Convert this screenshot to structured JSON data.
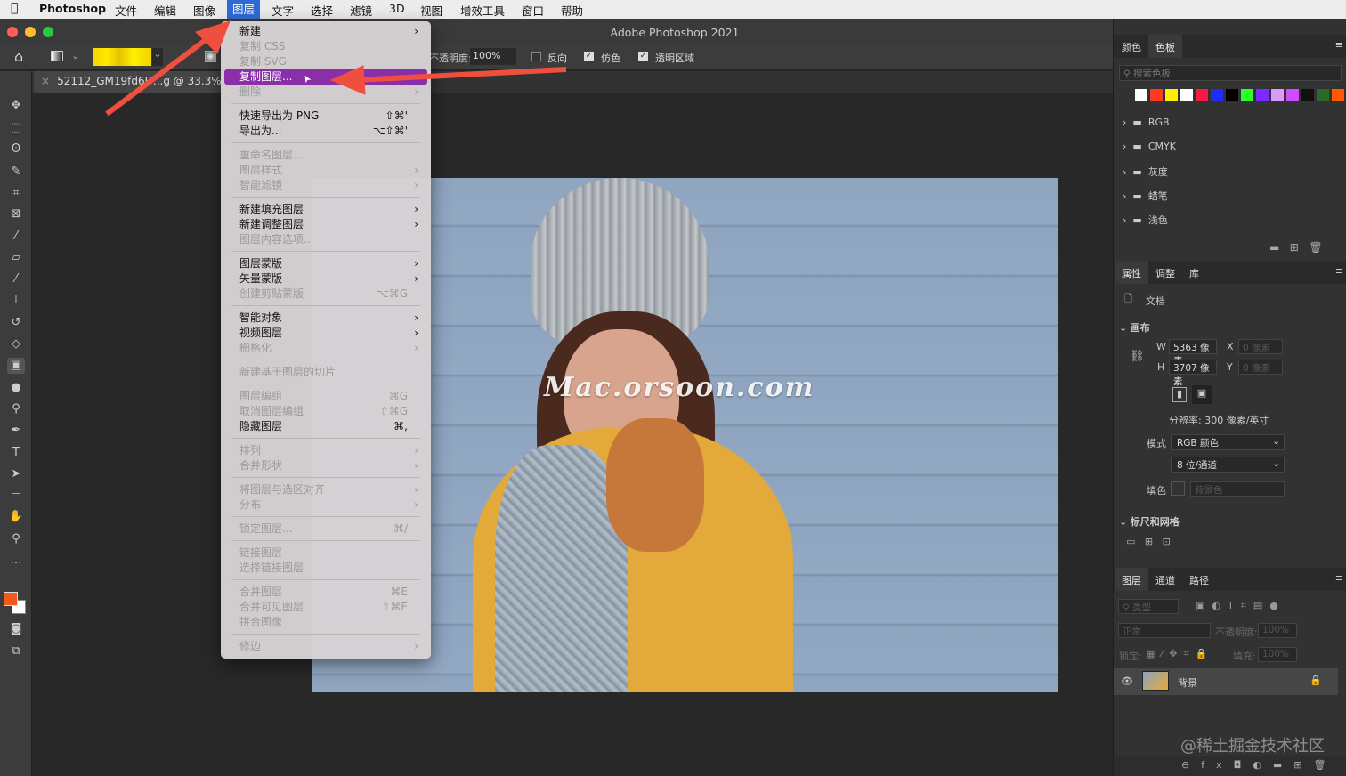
{
  "menubar": {
    "apple": "",
    "items": [
      "Photoshop",
      "文件",
      "编辑",
      "图像",
      "图层",
      "文字",
      "选择",
      "滤镜",
      "3D",
      "视图",
      "增效工具",
      "窗口",
      "帮助"
    ],
    "active": "图层"
  },
  "window": {
    "title": "Adobe Photoshop 2021"
  },
  "options": {
    "opacity_label": "不透明度:",
    "opacity_value": "100%",
    "reverse": "反向",
    "dither": "仿色",
    "transparency": "透明区域",
    "reverse_checked": false,
    "dither_checked": true,
    "transparency_checked": true,
    "gradient_colors": [
      "#f7d800",
      "#ffef00"
    ]
  },
  "document": {
    "tab": "52112_GM19fd6D...g @ 33.3%(RGB"
  },
  "watermark": "Mac.orsoon.com",
  "layer_menu": [
    {
      "label": "新建",
      "sub": true
    },
    {
      "label": "复制 CSS",
      "disabled": true
    },
    {
      "label": "复制 SVG",
      "disabled": true
    },
    {
      "label": "复制图层...",
      "highlight": true
    },
    {
      "label": "删除",
      "disabled": true,
      "sub": true
    },
    {
      "sep": true
    },
    {
      "label": "快速导出为 PNG",
      "shortcut": "⇧⌘'"
    },
    {
      "label": "导出为...",
      "shortcut": "⌥⇧⌘'"
    },
    {
      "sep": true
    },
    {
      "label": "重命名图层...",
      "disabled": true
    },
    {
      "label": "图层样式",
      "disabled": true,
      "sub": true
    },
    {
      "label": "智能滤镜",
      "disabled": true,
      "sub": true
    },
    {
      "sep": true
    },
    {
      "label": "新建填充图层",
      "sub": true
    },
    {
      "label": "新建调整图层",
      "sub": true
    },
    {
      "label": "图层内容选项...",
      "disabled": true
    },
    {
      "sep": true
    },
    {
      "label": "图层蒙版",
      "sub": true
    },
    {
      "label": "矢量蒙版",
      "sub": true
    },
    {
      "label": "创建剪贴蒙版",
      "disabled": true,
      "shortcut": "⌥⌘G"
    },
    {
      "sep": true
    },
    {
      "label": "智能对象",
      "sub": true
    },
    {
      "label": "视频图层",
      "sub": true
    },
    {
      "label": "栅格化",
      "disabled": true,
      "sub": true
    },
    {
      "sep": true
    },
    {
      "label": "新建基于图层的切片",
      "disabled": true
    },
    {
      "sep": true
    },
    {
      "label": "图层编组",
      "disabled": true,
      "shortcut": "⌘G"
    },
    {
      "label": "取消图层编组",
      "disabled": true,
      "shortcut": "⇧⌘G"
    },
    {
      "label": "隐藏图层",
      "shortcut": "⌘,"
    },
    {
      "sep": true
    },
    {
      "label": "排列",
      "disabled": true,
      "sub": true
    },
    {
      "label": "合并形状",
      "disabled": true,
      "sub": true
    },
    {
      "sep": true
    },
    {
      "label": "将图层与选区对齐",
      "disabled": true,
      "sub": true
    },
    {
      "label": "分布",
      "disabled": true,
      "sub": true
    },
    {
      "sep": true
    },
    {
      "label": "锁定图层...",
      "disabled": true,
      "shortcut": "⌘/"
    },
    {
      "sep": true
    },
    {
      "label": "链接图层",
      "disabled": true
    },
    {
      "label": "选择链接图层",
      "disabled": true
    },
    {
      "sep": true
    },
    {
      "label": "合并图层",
      "disabled": true,
      "shortcut": "⌘E"
    },
    {
      "label": "合并可见图层",
      "disabled": true,
      "shortcut": "⇧⌘E"
    },
    {
      "label": "拼合图像",
      "disabled": true
    },
    {
      "sep": true
    },
    {
      "label": "修边",
      "disabled": true,
      "sub": true
    }
  ],
  "swatches_panel": {
    "tabs": [
      "颜色",
      "色板"
    ],
    "search_placeholder": "搜索色板",
    "colors": [
      "#ffffff",
      "#ff3b1f",
      "#ffee00",
      "#ffffff",
      "#ff1744",
      "#1d2dff",
      "#000000",
      "#2cff2c",
      "#7a2cff",
      "#dd99ff",
      "#d24cff",
      "#101010",
      "#2a6a2a",
      "#ff5a00"
    ],
    "folders": [
      "RGB",
      "CMYK",
      "灰度",
      "蜡笔",
      "浅色"
    ]
  },
  "properties_panel": {
    "tabs": [
      "属性",
      "调整",
      "库"
    ],
    "doc_label": "文档",
    "canvas_section": "画布",
    "w_label": "W",
    "w_value": "5363 像素",
    "h_label": "H",
    "h_value": "3707 像素",
    "x_label": "X",
    "x_value": "0 像素",
    "y_label": "Y",
    "y_value": "0 像素",
    "resolution": "分辨率: 300 像素/英寸",
    "mode_label": "模式",
    "mode_value": "RGB 颜色",
    "depth_value": "8 位/通道",
    "fill_label": "填色",
    "fill_value": "背景色",
    "rulers_section": "标尺和网格"
  },
  "layers_panel": {
    "tabs": [
      "图层",
      "通道",
      "路径"
    ],
    "filter_placeholder": "类型",
    "blend_mode": "正常",
    "opacity_label": "不透明度:",
    "opacity_value": "100%",
    "lock_label": "锁定:",
    "fill_label": "填充:",
    "fill_value": "100%",
    "layers": [
      {
        "name": "背景",
        "visible": true,
        "locked": true
      }
    ]
  },
  "site_watermark": "@稀土掘金技术社区",
  "colors": {
    "highlight": "#8a2fa8",
    "arrow": "#ef4f3f",
    "foreground": "#f05a1a"
  }
}
